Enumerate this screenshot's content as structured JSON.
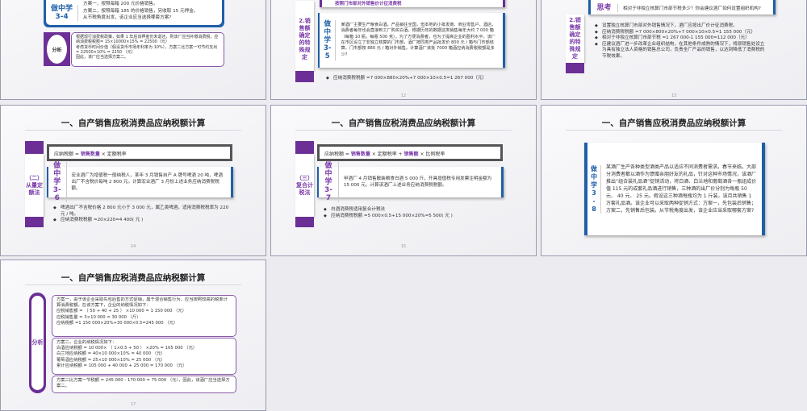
{
  "slides": [
    {
      "id": 11,
      "card_label": "做中学 3-4",
      "card_lines": [
        "方案一，按照每箱 200 元价格销售。",
        "方案二，按照每箱 185 的价格销售，另收取 15 元押金。",
        "从节税角度出发，该企业应当选择哪套方案?"
      ],
      "analysis_label": "分析",
      "analysis_lines": [
        "根据现行消费税政策，如果 1 年后该押金仍未退还，则该厂应当补缴消费税，应纳消费税税额= 15×10000×15% = 22500（元）",
        "考虑货币时间价值（假设货币市场年利率为 10%），方案二比方案一可节约支出= 22500×10% = 2250 （元）",
        "因此，该厂应当选择方案二。"
      ]
    },
    {
      "id": 12,
      "top_text": "按照门市部对外销售价计征消费税",
      "side": "2.销售额确定的特殊规定",
      "card_label": "做中学3-5",
      "card_text": "某酒厂主要生产粮食白酒，产品销往全国，但本地的小批发商、商业零售户、酒店、消费者每年也会直接到工厂购买白酒，根据历年的数据这类销售每年大约 7 000 箱（每箱 10 瓶，每瓶 500 克）。为了方便消费者，也为了提高企业的盈利水平，该厂在市区设立了非独立核算的门市部，酒厂按同类产品批发价 800 元 / 箱与门市部结算，门市部按 880 元 / 箱对外销售。计算酒厂该批 7000 箱酒应纳消费税税额是多少?",
      "bullets": [
        "应纳消费税税额 =7 000×880×20%+7 000×10×0.5=1 267 000（元）"
      ],
      "page": "12"
    },
    {
      "id": 13,
      "think_label": "思考",
      "think_text": "相对于非独立核算门市部节税多少？你会建议酒厂如何设置组织机构?",
      "side": "2.销售额确定的特殊规定",
      "bullets": [
        "设置独立核算门市部对外销售情况下，酒厂应按出厂价计征消费税。",
        "应纳消费税税额 =7 000×800×20%+7 000×10×0.5=1 155 000（元）",
        "相对于非独立核算门市部节税 =1 267 000-1 155 000=112 000（元）",
        "应建议酒厂进一步改革企业组织结构，在其他条件成熟的情况下，将原销售处设立为具有独立法人资格的销售总公司，负责全厂产品的销售，以达到降低了消费税的节税效果。"
      ],
      "page": "13"
    },
    {
      "id": 14,
      "title": "一、自产销售应税消费品应纳税额计算",
      "side": "（二）从量定额法",
      "formula": {
        "a": "应纳税额 = ",
        "b": "销售数量",
        "c": " × 定额税率"
      },
      "card_label": "做中学3-6",
      "card_text": "宏业酒厂为增值税一般纳税人，某年 3 月销售自产 A 牌号啤酒 20 吨，啤酒出厂不含税价每吨 2 800 元。计算宏业酒厂 3 月份上述业务应纳消费税税额。",
      "bullets": [
        "啤酒出厂不含税价格 2 800 元小于 3 000 元，属乙类啤酒，适用消费税税率为 220 元 / 吨。",
        "应纳消费税税额 =20×220=4 400( 元 )"
      ],
      "page": "14"
    },
    {
      "id": 15,
      "title": "一、自产销售应税消费品应纳税额计算",
      "side": "（三）复合计税法",
      "formula": {
        "a": "应纳税额 = ",
        "b": "销售数量",
        "c": " × 定额税率 + ",
        "d": "销售额",
        "e": " × 比例税率"
      },
      "card_label": "做中学3-7",
      "card_text": "甲酒厂 4 月销售散装粮食白酒 5 000 斤，开具增值税专用发票注明金额为 15 000 元。计算该酒厂上述业务应纳消费税税额。",
      "bullets": [
        "白酒消费税适用复合计税法",
        "应纳消费税税额 =5 000×0.5+15 000×20%=5 500( 元 )"
      ],
      "page": "15"
    },
    {
      "id": 16,
      "title": "一、自产销售应税消费品应纳税额计算",
      "card_label": "做中学3-8",
      "card_text": "某酒厂生产各种类型酒类产品以适应不同消费者需求。春节来临，大部分消费者都以酒作为馈赠亲朋好友的礼品，针对这种市场情况，该酒厂推出“组合装礼品酒”促销活动，将白酒、白兰地和葡萄酒各一瓶组成价值 115 元的成套礼品酒进行销售，三种酒的出厂价分别为每瓶 50 元、 40 元、 25 元。假设这三种酒每瓶均为 1 斤装，该月共销售 1 万套礼品酒。该企业可以采取两种促销方式：方案一，先包装后销售；方案二，先销售后包装。从节税角度出发，该企业应当采取哪套方案?"
    },
    {
      "id": 17,
      "title": "一、自产销售应税消费品应纳税额计算",
      "analysis_label": "分析",
      "box1": [
        "方案一，由于该企业采取先包后售的方式促销，属于混合销售行为，应当按照较高的税率计算消费税额。在该方案下，企业的纳税情况如下：",
        "应税销售额 = （ 50 + 40 + 25 ） ×10 000 = 1 150 000 （元）",
        "应税销售量 = 3×10 000 = 30 000 （斤）",
        "应纳税额 =1 150 000×20%+30 000×0.5=245 000 （元）"
      ],
      "box2": [
        "方案二，企业的纳税情况如下：",
        "白酒应纳税额 = 10 000× （ 1×0.5 + 50 ） ×20% = 105 000 （元）",
        "白兰地应纳税额 = 40×10 000×10% = 40 000 （元）",
        "葡萄酒应纳税额 = 25×10 000×10% = 25 000 （元）",
        "累计应纳税额 = 105 000 + 40 000 + 25 000 = 170 000 （元）"
      ],
      "box3": [
        "方案二比方案一节税额 = 245 000 - 170 000 = 75 000 （元），因此，该酒厂应当选择方案二。"
      ],
      "page": "17"
    }
  ],
  "colors": {
    "purple": "#6b2f95",
    "blue": "#1f5fa8"
  }
}
